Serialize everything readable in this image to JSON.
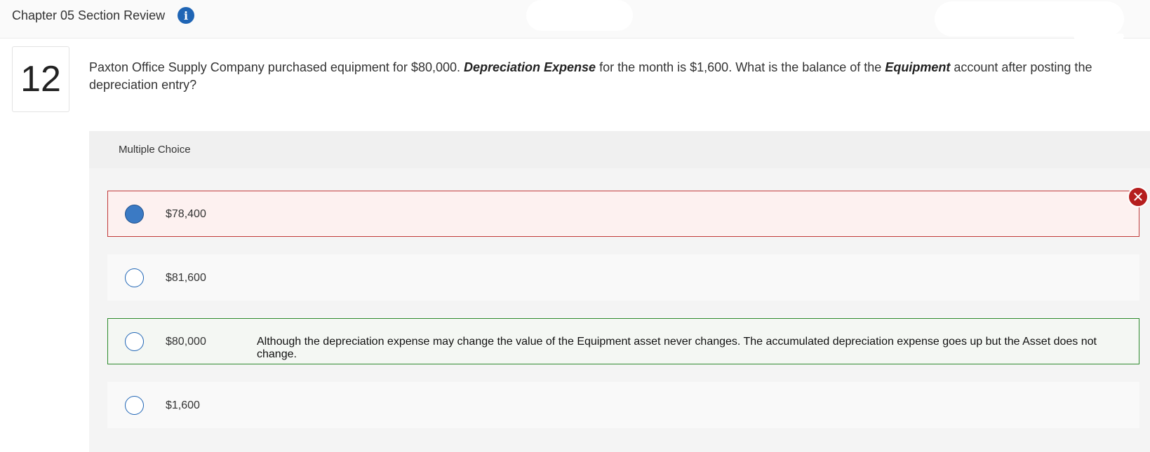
{
  "header": {
    "title": "Chapter 05 Section Review",
    "info_icon": "info-icon"
  },
  "question": {
    "number": "12",
    "text_part1": "Paxton Office Supply Company purchased equipment for $80,000. ",
    "emphasis1": "Depreciation Expense",
    "text_part2": " for the month is $1,600. What is the balance of the ",
    "emphasis2": "Equipment",
    "text_part3": " account after posting the depreciation entry?"
  },
  "answer_panel": {
    "type_label": "Multiple Choice",
    "choices": [
      {
        "label": "$78,400",
        "selected": true,
        "status": "incorrect",
        "feedback": ""
      },
      {
        "label": "$81,600",
        "selected": false,
        "status": "none",
        "feedback": ""
      },
      {
        "label": "$80,000",
        "selected": false,
        "status": "correct",
        "feedback": "Although the depreciation expense may change the value of the Equipment asset never changes. The accumulated depreciation expense goes up but the Asset does not change."
      },
      {
        "label": "$1,600",
        "selected": false,
        "status": "none",
        "feedback": ""
      }
    ],
    "incorrect_icon": "close-icon"
  },
  "colors": {
    "accent": "#1f65b5",
    "incorrect": "#c13a3a",
    "correct": "#2d8a2d"
  }
}
